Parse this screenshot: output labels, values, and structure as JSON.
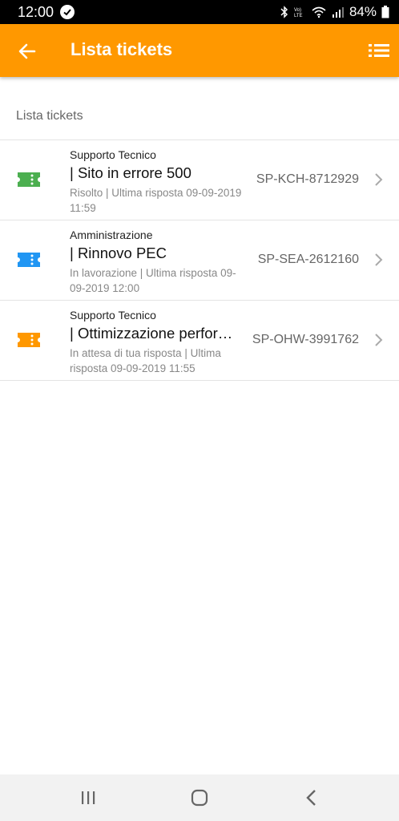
{
  "status_bar": {
    "time": "12:00",
    "battery": "84%",
    "icons": [
      "check-circle-icon",
      "bluetooth-icon",
      "volte-icon",
      "wifi-icon",
      "signal-icon",
      "battery-icon"
    ]
  },
  "app_bar": {
    "title": "Lista tickets",
    "back_icon": "arrow-left-icon",
    "menu_icon": "list-menu-icon",
    "color": "#ff9800"
  },
  "section": {
    "header": "Lista tickets"
  },
  "tickets": [
    {
      "category": "Supporto Tecnico",
      "title": "| Sito in errore 500",
      "status": "Risolto | Ultima risposta 09-09-2019 11:59",
      "code": "SP-KCH-8712929",
      "icon": "ticket-icon",
      "icon_color": "#4caf50"
    },
    {
      "category": "Amministrazione",
      "title": "| Rinnovo PEC",
      "status": "In lavorazione | Ultima risposta 09-09-2019 12:00",
      "code": "SP-SEA-2612160",
      "icon": "ticket-icon",
      "icon_color": "#2196f3"
    },
    {
      "category": "Supporto Tecnico",
      "title": "| Ottimizzazione performance",
      "status": "In attesa di tua risposta | Ultima risposta 09-09-2019 11:55",
      "code": "SP-OHW-3991762",
      "icon": "ticket-icon",
      "icon_color": "#ff9800"
    }
  ],
  "nav_bar": {
    "icons": [
      "recent-apps-icon",
      "home-icon",
      "back-icon"
    ]
  }
}
